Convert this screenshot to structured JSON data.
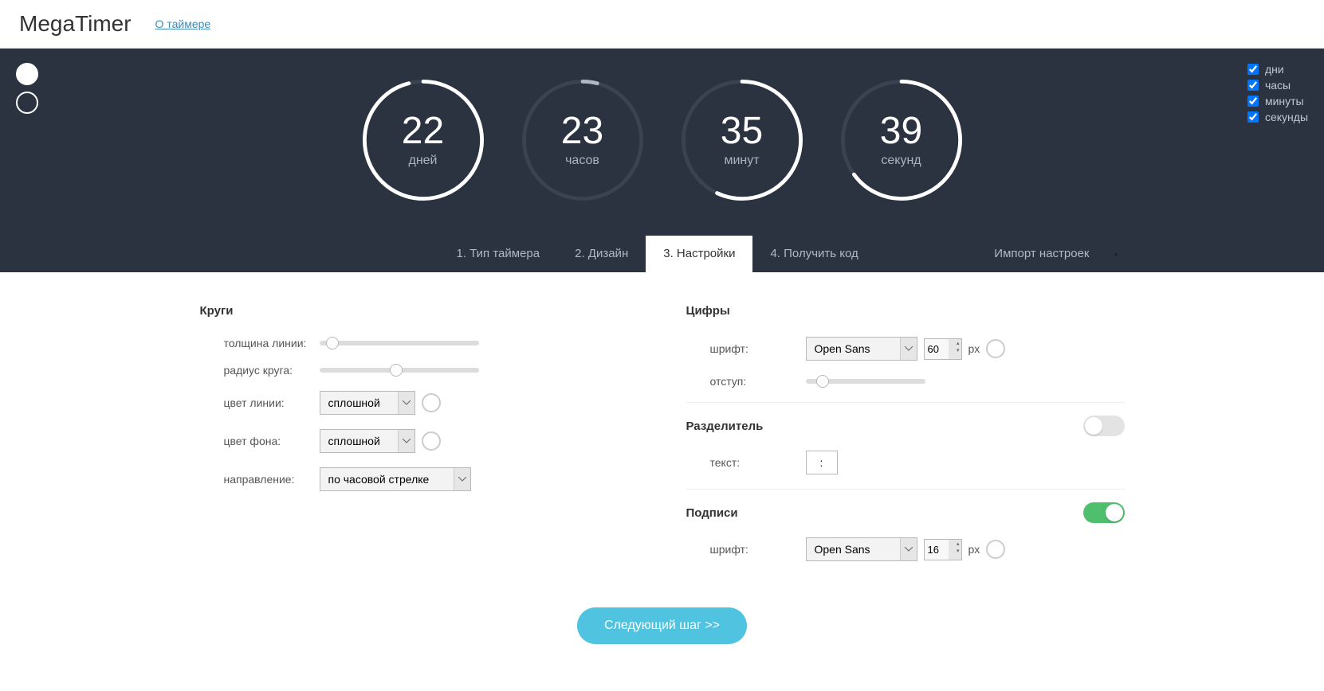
{
  "header": {
    "logo": "MegaTimer",
    "about": "О таймере"
  },
  "checkboxes": {
    "days": {
      "label": "дни",
      "checked": true
    },
    "hours": {
      "label": "часы",
      "checked": true
    },
    "minutes": {
      "label": "минуты",
      "checked": true
    },
    "seconds": {
      "label": "секунды",
      "checked": true
    }
  },
  "timer": {
    "days": {
      "value": "22",
      "label": "дней",
      "fraction": 0.96,
      "stroke": "#ffffff"
    },
    "hours": {
      "value": "23",
      "label": "часов",
      "fraction": 0.04,
      "stroke": "#b0b8c6"
    },
    "minutes": {
      "value": "35",
      "label": "минут",
      "fraction": 0.57,
      "stroke": "#ffffff"
    },
    "seconds": {
      "value": "39",
      "label": "секунд",
      "fraction": 0.65,
      "stroke": "#ffffff"
    }
  },
  "tabs": {
    "type": "1. Тип таймера",
    "design": "2. Дизайн",
    "settings": "3. Настройки",
    "code": "4. Получить код",
    "import": "Импорт настроек"
  },
  "sections": {
    "circles": "Круги",
    "digits": "Цифры",
    "divider": "Разделитель",
    "labels": "Подписи"
  },
  "fields": {
    "lineWidth": "толщина линии:",
    "radius": "радиус круга:",
    "lineColor": "цвет линии:",
    "bgColor": "цвет фона:",
    "direction": "направление:",
    "font": "шрифт:",
    "offset": "отступ:",
    "text": "текст:",
    "px": "px"
  },
  "values": {
    "lineWidthPos": 8,
    "radiusPos": 48,
    "offsetPos": 14,
    "lineColorMode": "сплошной",
    "bgColorMode": "сплошной",
    "direction": "по часовой стрелке",
    "digitsFont": "Open Sans",
    "digitsSize": "60",
    "dividerEnabled": false,
    "dividerText": ":",
    "labelsEnabled": true,
    "labelsFont": "Open Sans",
    "labelsSize": "16"
  },
  "nextButton": "Следующий шаг >>"
}
